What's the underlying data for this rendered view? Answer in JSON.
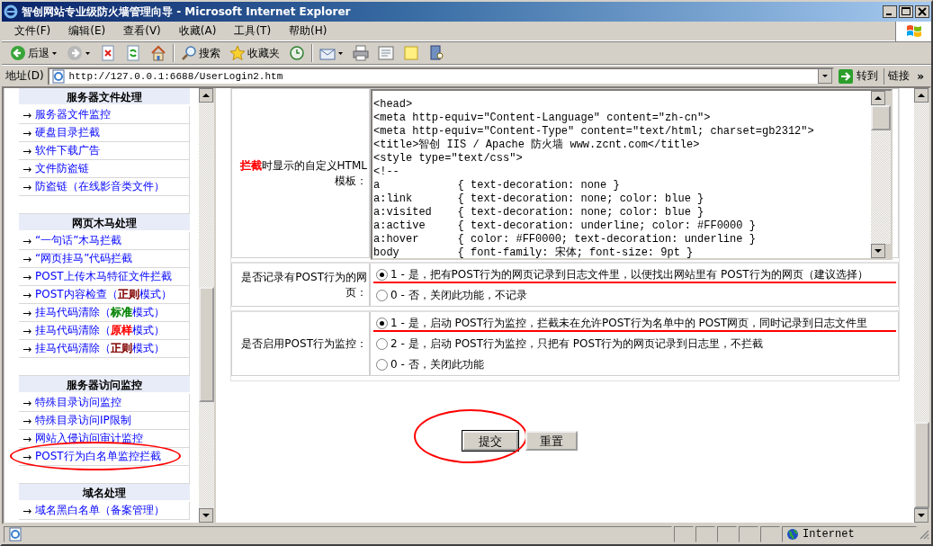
{
  "window": {
    "title": "智创网站专业级防火墙管理向导 - Microsoft Internet Explorer"
  },
  "menu": [
    "文件(F)",
    "编辑(E)",
    "查看(V)",
    "收藏(A)",
    "工具(T)",
    "帮助(H)"
  ],
  "toolbar": [
    {
      "kind": "back",
      "label": "后退",
      "dropdown": true
    },
    {
      "kind": "forward",
      "dropdown": true
    },
    {
      "kind": "stop"
    },
    {
      "kind": "refresh"
    },
    {
      "kind": "home"
    },
    {
      "kind": "separator"
    },
    {
      "kind": "search",
      "label": "搜索"
    },
    {
      "kind": "favorites",
      "label": "收藏夹"
    },
    {
      "kind": "history"
    },
    {
      "kind": "separator"
    },
    {
      "kind": "mail",
      "dropdown": true
    },
    {
      "kind": "print"
    },
    {
      "kind": "edit"
    },
    {
      "kind": "note"
    },
    {
      "kind": "research"
    }
  ],
  "address_bar": {
    "label": "地址(D)",
    "url": "http://127.0.0.1:6688/UserLogin2.htm",
    "go": "转到",
    "links": "链接",
    "chevron": "»"
  },
  "sidebar": {
    "sections": [
      {
        "title": "服务器文件处理",
        "items": [
          {
            "bullet": "→",
            "segments": [
              {
                "text": "服务器文件监控"
              }
            ],
            "circled": false
          },
          {
            "bullet": "→",
            "segments": [
              {
                "text": "硬盘目录拦截"
              }
            ],
            "circled": false
          },
          {
            "bullet": "→",
            "segments": [
              {
                "text": "软件下载广告"
              }
            ],
            "circled": false
          },
          {
            "bullet": "→",
            "segments": [
              {
                "text": "文件防盗链"
              }
            ],
            "circled": false
          },
          {
            "bullet": "→",
            "segments": [
              {
                "text": "防盗链（在线影音类文件）"
              }
            ],
            "circled": false
          }
        ]
      },
      {
        "title": "网页木马处理",
        "items": [
          {
            "bullet": "→",
            "segments": [
              {
                "text": "“一句话”木马拦截"
              }
            ],
            "circled": false
          },
          {
            "bullet": "→",
            "segments": [
              {
                "text": "“网页挂马”代码拦截"
              }
            ],
            "circled": false
          },
          {
            "bullet": "→",
            "segments": [
              {
                "text": "POST上传木马特征文件拦截"
              }
            ],
            "circled": false
          },
          {
            "bullet": "→",
            "segments": [
              {
                "text": "POST内容检查（"
              },
              {
                "text": "正则",
                "color": "#800000"
              },
              {
                "text": "模式）"
              }
            ],
            "circled": false
          },
          {
            "bullet": "→",
            "segments": [
              {
                "text": "挂马代码清除（"
              },
              {
                "text": "标准",
                "color": "#008000"
              },
              {
                "text": "模式）"
              }
            ],
            "circled": false
          },
          {
            "bullet": "→",
            "segments": [
              {
                "text": "挂马代码清除（"
              },
              {
                "text": "原样",
                "color": "#ff0000"
              },
              {
                "text": "模式）"
              }
            ],
            "circled": false
          },
          {
            "bullet": "→",
            "segments": [
              {
                "text": "挂马代码清除（"
              },
              {
                "text": "正则",
                "color": "#800000"
              },
              {
                "text": "模式）"
              }
            ],
            "circled": false
          }
        ]
      },
      {
        "title": "服务器访问监控",
        "items": [
          {
            "bullet": "→",
            "segments": [
              {
                "text": "特殊目录访问监控"
              }
            ],
            "circled": false
          },
          {
            "bullet": "→",
            "segments": [
              {
                "text": "特殊目录访问IP限制"
              }
            ],
            "circled": false
          },
          {
            "bullet": "→",
            "segments": [
              {
                "text": "网站入侵访问审计监控"
              }
            ],
            "circled": false
          },
          {
            "bullet": "→",
            "segments": [
              {
                "text": "POST行为白名单监控拦截"
              }
            ],
            "circled": true
          }
        ]
      },
      {
        "title": "域名处理",
        "items": [
          {
            "bullet": "→",
            "segments": [
              {
                "text": "域名黑白名单（备案管理）"
              }
            ],
            "circled": false
          }
        ]
      }
    ]
  },
  "form": {
    "rows": [
      {
        "kind": "template",
        "label": [
          {
            "text": "拦截",
            "color": "#ff0000"
          },
          {
            "text": "时显示的自定义HTML模板："
          }
        ],
        "code_lines": [
          "<head>",
          "<meta http-equiv=\"Content-Language\" content=\"zh-cn\">",
          "<meta http-equiv=\"Content-Type\" content=\"text/html; charset=gb2312\">",
          "<title>智创 IIS / Apache 防火墙 www.zcnt.com</title>",
          "<style type=\"text/css\">",
          "<!--",
          "a            { text-decoration: none }",
          "a:link       { text-decoration: none; color: blue }",
          "a:visited    { text-decoration: none; color: blue }",
          "a:active     { text-decoration: underline; color: #FF0000 }",
          "a:hover      { color: #FF0000; text-decoration: underline }",
          "body         { font-family: 宋体; font-size: 9pt }"
        ]
      },
      {
        "kind": "radio",
        "label": [
          {
            "text": "是否记录有POST行为的网页："
          }
        ],
        "options": [
          {
            "text": "1 - 是，把有POST行为的网页记录到日志文件里，以便找出网站里有 POST行为的网页（建议选择）",
            "selected": true,
            "underlined": true
          },
          {
            "text": "0 - 否，关闭此功能，不记录",
            "selected": false,
            "underlined": false
          }
        ]
      },
      {
        "kind": "radio",
        "label": [
          {
            "text": "是否启用POST行为监控："
          }
        ],
        "options": [
          {
            "text": "1 - 是，启动 POST行为监控，拦截未在允许POST行为名单中的 POST网页，同时记录到日志文件里",
            "selected": true,
            "underlined": true
          },
          {
            "text": "2 - 是，启动 POST行为监控，只把有 POST行为的网页记录到日志里，不拦截",
            "selected": false,
            "underlined": false
          },
          {
            "text": "0 - 否，关闭此功能",
            "selected": false,
            "underlined": false
          }
        ]
      }
    ]
  },
  "buttons": [
    {
      "label": "提交",
      "default": true,
      "circled": true
    },
    {
      "label": "重置",
      "default": false,
      "circled": false
    }
  ],
  "status_bar": {
    "zone": "Internet"
  }
}
